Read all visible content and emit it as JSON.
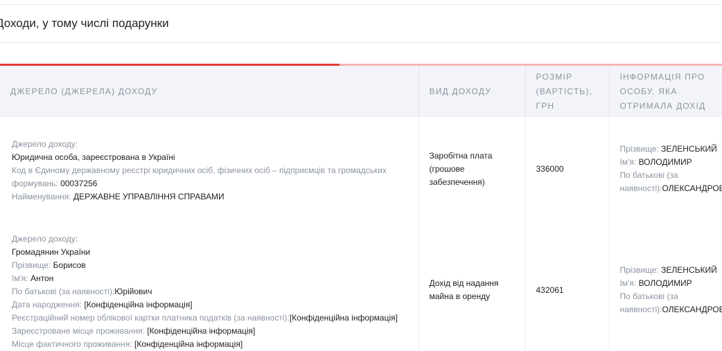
{
  "section": {
    "title": "Доходи, у тому числі подарунки"
  },
  "table": {
    "headers": {
      "source": "ДЖЕРЕЛО (ДЖЕРЕЛА) ДОХОДУ",
      "type": "ВИД ДОХОДУ",
      "amount": "РОЗМІР (ВАРТІСТЬ), ГРН",
      "recipient": "ІНФОРМАЦІЯ ПРО ОСОБУ, ЯКА ОТРИМАЛА ДОХІД"
    },
    "rows": [
      {
        "source": {
          "source_label": "Джерело доходу:",
          "source_value": "Юридична особа, зареєстрована в Україні",
          "code_label": "Код в Єдиному державному реєстрі юридичних осіб, фізичних осіб – підприємців та громадських формувань:",
          "code_value": "00037256",
          "name_label": "Найменування:",
          "name_value": "ДЕРЖАВНЕ УПРАВЛІННЯ СПРАВАМИ"
        },
        "type": "Заробітна плата (грошове забезпечення)",
        "amount": "336000",
        "recipient": {
          "surname_label": "Прізвище:",
          "surname_value": "ЗЕЛЕНСЬКИЙ",
          "name_label": "Ім'я:",
          "name_value": "ВОЛОДИМИР",
          "patronymic_label": "По батькові (за наявності):",
          "patronymic_value": "ОЛЕКСАНДРОВИЧ"
        }
      },
      {
        "source": {
          "source_label": "Джерело доходу:",
          "source_value": "Громадянин України",
          "surname_label": "Прізвище:",
          "surname_value": "Борисов",
          "name_label": "Ім'я:",
          "name_value": "Антон",
          "patronymic_label": "По батькові (за наявності):",
          "patronymic_value": "Юрійович",
          "birth_label": "Дата народження:",
          "birth_value": "[Конфіденційна інформація]",
          "tax_label": "Реєстраційний номер облікової картки платника податків (за наявності):",
          "tax_value": "[Конфіденційна інформація]",
          "reg_label": "Зареєстроване місце проживання:",
          "reg_value": "[Конфіденційна інформація]",
          "actual_label": "Місце фактичного проживання:",
          "actual_value": "[Конфіденційна інформація]"
        },
        "type": "Дохід від надання майна в оренду",
        "amount": "432061",
        "recipient": {
          "surname_label": "Прізвище:",
          "surname_value": "ЗЕЛЕНСЬКИЙ",
          "name_label": "Ім'я:",
          "name_value": "ВОЛОДИМИР",
          "patronymic_label": "По батькові (за наявності):",
          "patronymic_value": "ОЛЕКСАНДРОВИЧ"
        }
      }
    ]
  },
  "colors": {
    "accent": "#e03c35",
    "accent_light": "#f2b4b1",
    "header_bg": "#f2f4f7",
    "label": "#8a93a0",
    "text": "#1e1e1e"
  }
}
